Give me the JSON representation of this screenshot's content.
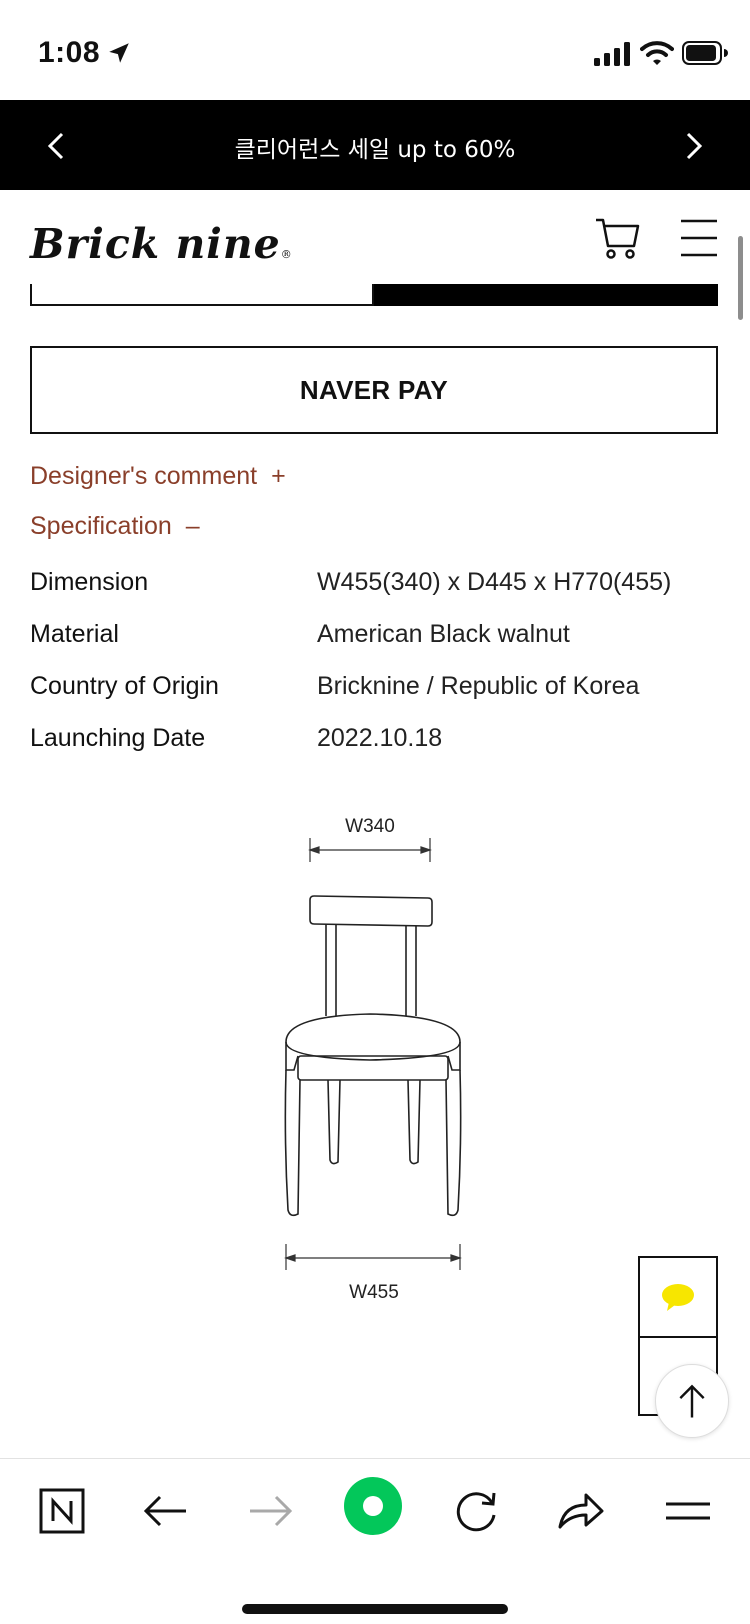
{
  "status_bar": {
    "time": "1:08"
  },
  "promo": {
    "text": "클리어런스 세일 up to 60%"
  },
  "header": {
    "logo": "Brick nine",
    "logo_mark": "®"
  },
  "buttons": {
    "naver_pay": "NAVER PAY"
  },
  "accordion": [
    {
      "label": "Designer's comment",
      "sign": "+"
    },
    {
      "label": "Specification",
      "sign": "–"
    }
  ],
  "specs": [
    {
      "label": "Dimension",
      "value": "W455(340) x D445 x H770(455)"
    },
    {
      "label": "Material",
      "value": "American Black walnut"
    },
    {
      "label": "Country of Origin",
      "value": "Bricknine / Republic of Korea"
    },
    {
      "label": "Launching Date",
      "value": "2022.10.18"
    }
  ],
  "drawing": {
    "top_dim": "W340",
    "bottom_dim": "W455"
  },
  "colors": {
    "accent": "#8a3f2a",
    "naver_green": "#03c75a",
    "kakao_yellow": "#f7e600"
  }
}
